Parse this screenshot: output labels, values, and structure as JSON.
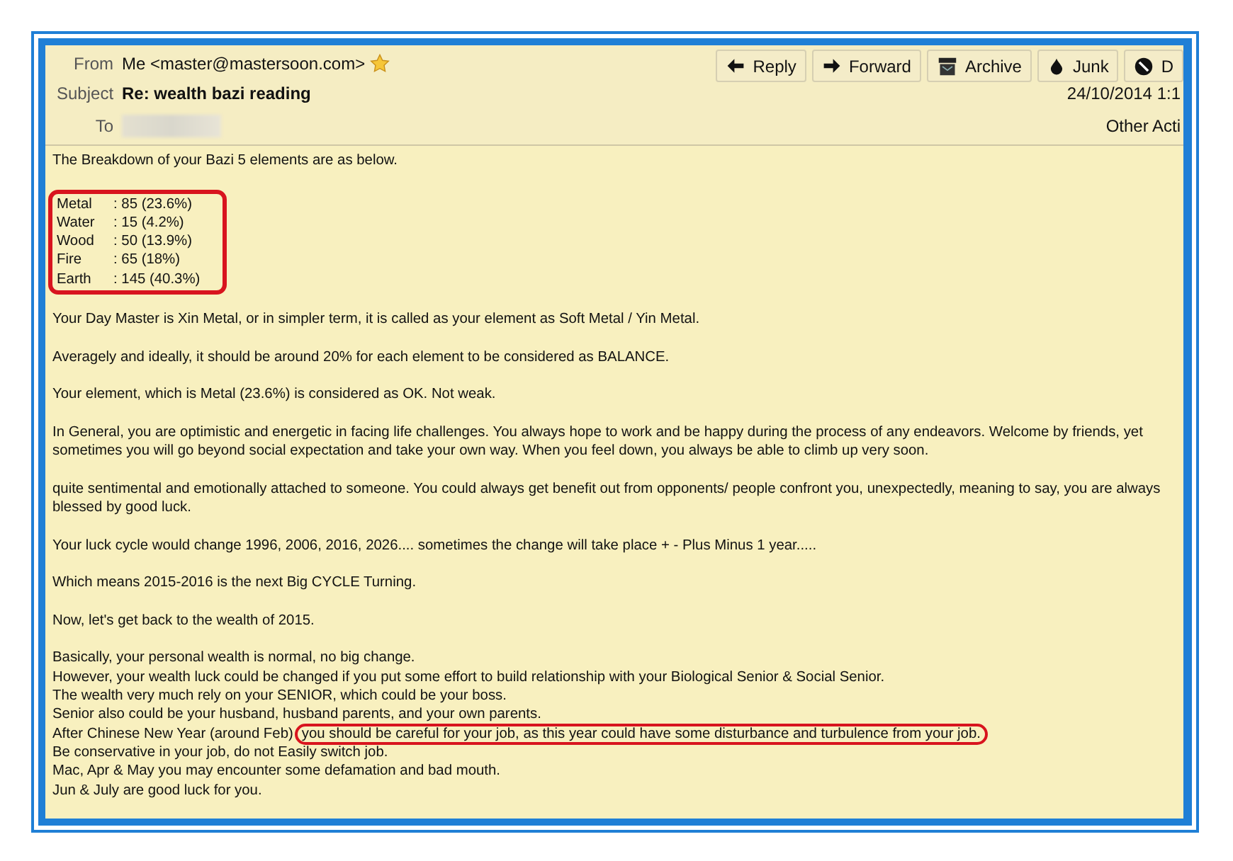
{
  "header": {
    "from_label": "From",
    "from": "Me <master@mastersoon.com>",
    "starred": true,
    "subject_label": "Subject",
    "subject": "Re: wealth bazi reading",
    "to_label": "To",
    "date": "24/10/2014 1:1",
    "other_actions": "Other Acti"
  },
  "toolbar": [
    {
      "label": "Reply",
      "kind": "reply"
    },
    {
      "label": "Forward",
      "kind": "forward"
    },
    {
      "label": "Archive",
      "kind": "archive"
    },
    {
      "label": "Junk",
      "kind": "junk"
    },
    {
      "label": "D",
      "kind": "delete"
    }
  ],
  "body": {
    "intro": "The Breakdown of your Bazi 5 elements are as below.",
    "elements": {
      "highlighted": true,
      "rows": [
        {
          "name": "Metal",
          "value": ": 85 (23.6%)"
        },
        {
          "name": "Water",
          "value": ": 15 (4.2%)"
        },
        {
          "name": "Wood",
          "value": ": 50 (13.9%)"
        },
        {
          "name": "Fire",
          "value": ": 65 (18%)"
        },
        {
          "name": "Earth",
          "value": ": 145 (40.3%)"
        }
      ]
    },
    "paragraphs": [
      {
        "lines": [
          {
            "text": "Your Day Master is Xin Metal, or in simpler term, it is called as your element as Soft Metal / Yin Metal."
          }
        ]
      },
      {
        "lines": [
          {
            "text": "Averagely and ideally, it should be around 20% for each element to be considered as BALANCE."
          }
        ]
      },
      {
        "lines": [
          {
            "text": "Your element, which is Metal (23.6%) is considered as OK. Not weak."
          }
        ]
      },
      {
        "lines": [
          {
            "text": "In General, you are optimistic and energetic in facing life challenges. You always hope to work and be happy during the process of any endeavors. Welcome by friends, yet"
          },
          {
            "text": "sometimes you will go beyond social expectation and take your own way. When you feel down, you always be able to climb up very soon."
          }
        ]
      },
      {
        "lines": [
          {
            "text": "quite sentimental and emotionally attached to someone. You could always get benefit out from opponents/ people confront you, unexpectedly, meaning to say, you are always"
          },
          {
            "text": "blessed by good luck."
          }
        ]
      },
      {
        "lines": [
          {
            "text": "Your luck cycle would change 1996, 2006, 2016, 2026.... sometimes the change will take place + - Plus Minus 1 year....."
          }
        ]
      },
      {
        "lines": [
          {
            "text": "Which means 2015-2016 is the next Big CYCLE Turning."
          }
        ]
      },
      {
        "lines": [
          {
            "text": "Now, let's get back to the wealth of 2015."
          }
        ]
      },
      {
        "lines": [
          {
            "text": "Basically, your personal wealth is normal, no big change."
          },
          {
            "text": "However, your wealth luck could be changed if you put some effort to build relationship with your Biological Senior & Social Senior."
          },
          {
            "text": "The wealth very much rely on your SENIOR, which could be your boss."
          },
          {
            "text": "Senior also could be your husband, husband parents, and your own parents."
          },
          {
            "text": "After Chinese New Year (around Feb)",
            "highlight": "you should be careful for your job, as this year could have some disturbance and turbulence from your job."
          },
          {
            "text": "Be conservative in your job, do not Easily switch job."
          },
          {
            "text": "Mac, Apr & May  you may encounter some defamation and bad mouth."
          },
          {
            "text": "Jun & July are good luck for you."
          }
        ]
      }
    ]
  }
}
